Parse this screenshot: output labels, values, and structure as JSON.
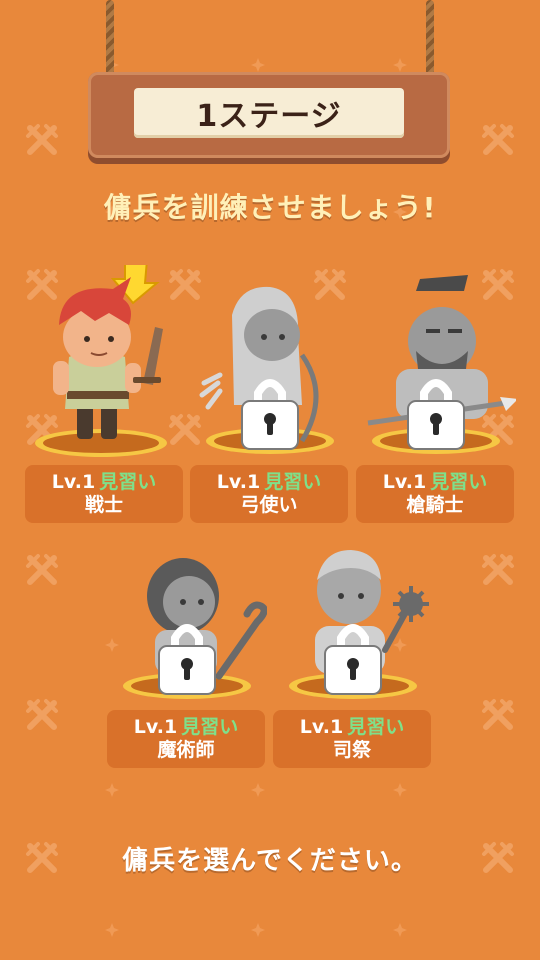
{
  "header": {
    "title": "1ステージ"
  },
  "subtitle": "傭兵を訓練させましょう!",
  "footer": "傭兵を選んでください。",
  "colors": {
    "background": "#e8883b",
    "card": "#d9712a",
    "rank_text": "#7fe08a",
    "subtitle_text": "#fff0b8"
  },
  "units": [
    {
      "level": "Lv.1",
      "rank": "見習い",
      "name": "戦士",
      "locked": false,
      "icon": "warrior-character"
    },
    {
      "level": "Lv.1",
      "rank": "見習い",
      "name": "弓使い",
      "locked": true,
      "icon": "archer-character"
    },
    {
      "level": "Lv.1",
      "rank": "見習い",
      "name": "槍騎士",
      "locked": true,
      "icon": "lancer-character"
    },
    {
      "level": "Lv.1",
      "rank": "見習い",
      "name": "魔術師",
      "locked": true,
      "icon": "mage-character"
    },
    {
      "level": "Lv.1",
      "rank": "見習い",
      "name": "司祭",
      "locked": true,
      "icon": "priest-character"
    }
  ]
}
